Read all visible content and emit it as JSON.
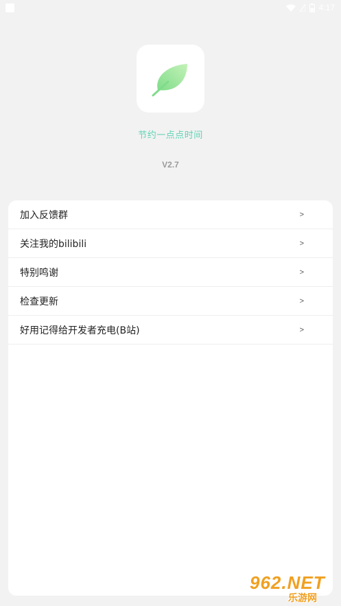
{
  "status_bar": {
    "time": "4:17",
    "icons": [
      "notification-icon",
      "wifi-icon",
      "sim-icon",
      "battery-icon"
    ]
  },
  "header": {
    "app_icon": "leaf-icon",
    "slogan": "节约一点点时间",
    "version": "V2.7"
  },
  "menu": {
    "items": [
      {
        "label": "加入反馈群",
        "arrow": ">"
      },
      {
        "label": "关注我的bilibili",
        "arrow": ">"
      },
      {
        "label": "特别鸣谢",
        "arrow": ">"
      },
      {
        "label": "检查更新",
        "arrow": ">"
      },
      {
        "label": "好用记得给开发者充电(B站)",
        "arrow": ">"
      }
    ]
  },
  "watermark": {
    "top": "962.NET",
    "bottom": "乐游网"
  },
  "colors": {
    "background": "#f2f2f2",
    "accent": "#5fd3b4",
    "leaf_light": "#b8f0b0",
    "leaf_dark": "#7fdc8a",
    "version_gray": "#9a9a9a"
  }
}
